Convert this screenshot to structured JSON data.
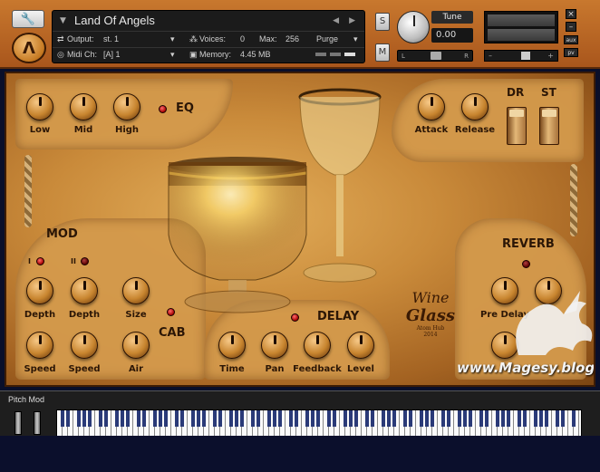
{
  "header": {
    "instrument_name": "Land Of Angels",
    "output_label": "Output:",
    "output_value": "st. 1",
    "voices_label": "Voices:",
    "voices_value": "0",
    "max_label": "Max:",
    "max_value": "256",
    "purge_label": "Purge",
    "midi_label": "Midi Ch:",
    "midi_value": "[A] 1",
    "memory_label": "Memory:",
    "memory_value": "4.45 MB",
    "solo_label": "S",
    "mute_label": "M",
    "tune_label": "Tune",
    "tune_value": "0.00",
    "pan_left": "L",
    "pan_right": "R",
    "aux_label": "aux",
    "pv_label": "pv",
    "close_label": "×",
    "min_label": "–"
  },
  "eq": {
    "title": "EQ",
    "knobs": [
      "Low",
      "Mid",
      "High"
    ]
  },
  "env": {
    "knobs": [
      "Attack",
      "Release"
    ],
    "dr_label": "DR",
    "st_label": "ST"
  },
  "mod": {
    "title": "MOD",
    "num1": "I",
    "num2": "II",
    "row1": [
      "Depth",
      "Depth",
      "Size"
    ],
    "row2": [
      "Speed",
      "Speed",
      "Air"
    ]
  },
  "cab": {
    "title": "CAB"
  },
  "delay": {
    "title": "DELAY",
    "knobs": [
      "Time",
      "Pan",
      "Feedback",
      "Level"
    ]
  },
  "reverb": {
    "title": "REVERB",
    "knobs": [
      "Pre Delay"
    ]
  },
  "logo": {
    "line1": "Wine",
    "line2": "Glass",
    "line3": "Atom Hub",
    "line4": "2014"
  },
  "watermark": "www.Magesy.blog",
  "bottom": {
    "pitch_mod_label": "Pitch Mod"
  }
}
